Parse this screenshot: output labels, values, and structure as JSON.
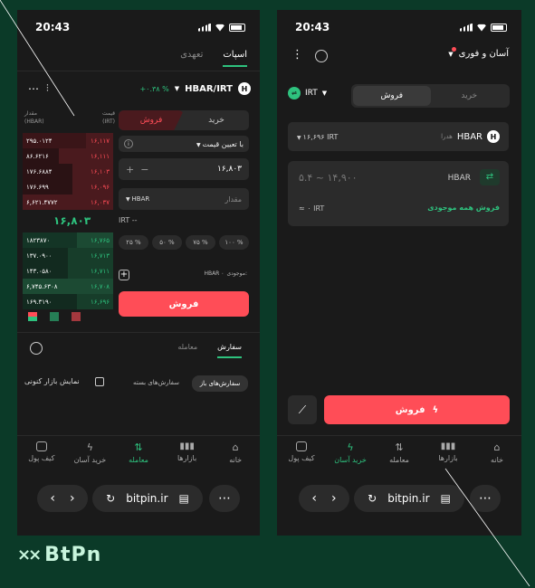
{
  "status": {
    "time": "20:43"
  },
  "left": {
    "tabs": {
      "spot": "اسپات",
      "futures": "تعهدی"
    },
    "pair": {
      "name": "HBAR/IRT",
      "change": "+۰.۳۸ %"
    },
    "orderbook": {
      "col_price": "قیمت (IRT)",
      "col_amount": "مقدار (HBAR)",
      "asks": [
        {
          "price": "۱۶,۱۱۷",
          "amount": "۲۹۵.۰۱۲۴"
        },
        {
          "price": "۱۶,۱۱۱",
          "amount": "۸۶.۶۲۱۶"
        },
        {
          "price": "۱۶,۱۰۳",
          "amount": "۱۷۶.۶۸۸۴"
        },
        {
          "price": "۱۶,۰۹۶",
          "amount": "۱۷۶.۶۹۹"
        },
        {
          "price": "۱۶,۰۳۷",
          "amount": "۶,۶۲۱.۴۷۷۲"
        }
      ],
      "last_price": "۱۶,۸۰۳",
      "bids": [
        {
          "price": "۱۶,۷۶۵",
          "amount": "۱۸۲۳۸۷۰"
        },
        {
          "price": "۱۶,۷۱۳",
          "amount": "۱۳۷.۰۹۰۰"
        },
        {
          "price": "۱۶,۷۱۱",
          "amount": "۱۴۳.۰۵۸۰"
        },
        {
          "price": "۱۶,۷۰۸",
          "amount": "۶,۷۴۵.۶۳۰۸"
        },
        {
          "price": "۱۶,۶۹۶",
          "amount": "۱۶۹.۳۱۹۰"
        }
      ]
    },
    "form": {
      "buy_tab": "خرید",
      "sell_tab": "فروش",
      "order_type": "با تعیین قیمت",
      "price_value": "۱۶,۸۰۳",
      "amount_label": "مقدار",
      "amount_unit": "HBAR",
      "irt": "IRT --",
      "percents": [
        "۱۰۰ %",
        "۷۵ %",
        "۵۰ %",
        "۲۵ %"
      ],
      "balance_label": "موجودی:",
      "balance_value": "HBAR ۰",
      "sell_button": "فروش"
    },
    "orders": {
      "tab_orders": "سفارش",
      "tab_trades": "معامله",
      "open_orders": "سفارش‌های باز",
      "closed_orders": "سفارش‌های بسته",
      "show_current": "نمایش بازار کنونی"
    },
    "nav": [
      "خانه",
      "بازارها",
      "معامله",
      "خرید آسان",
      "کیف پول"
    ],
    "url": "bitpin.ir"
  },
  "right": {
    "title": "آسان و فوری",
    "mode": {
      "buy": "خرید",
      "sell": "فروش"
    },
    "currency": "IRT",
    "asset": {
      "symbol": "HBAR",
      "name": "هدرا",
      "price": "۱۶,۶۹۶ IRT"
    },
    "amount_placeholder": "۵.۴ ~ ۱۴,۹۰۰",
    "amount_unit": "HBAR",
    "sell_all": "فروش همه موجودی",
    "approx": "≈ ۰ IRT",
    "sell_button": "فروش",
    "nav": [
      "خانه",
      "بازارها",
      "معامله",
      "خرید آسان",
      "کیف پول"
    ],
    "url": "bitpin.ir"
  },
  "brand": "BtPn",
  "colors": {
    "green": "#2ec27e",
    "red": "#ff4d57",
    "bg": "#0b3a28"
  }
}
